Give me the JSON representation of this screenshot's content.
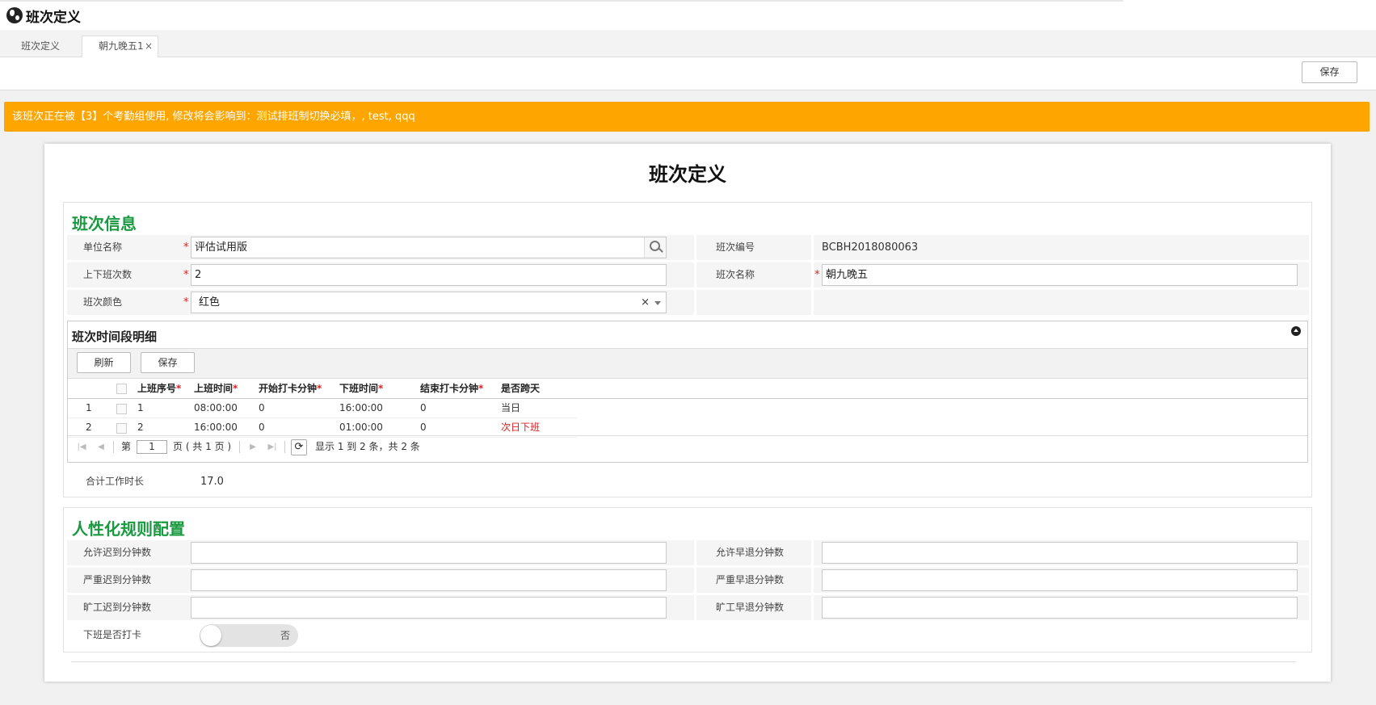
{
  "app": {
    "title": "班次定义"
  },
  "tabs": [
    {
      "label": "班次定义"
    },
    {
      "label": "朝九晚五1",
      "close": "×"
    }
  ],
  "toolbar": {
    "save_label": "保存"
  },
  "warning": {
    "text": "该班次正在被【3】个考勤组使用, 修改将会影响到：测试排班制切换必填，, test, qqq"
  },
  "form": {
    "title": "班次定义",
    "info_section": {
      "title": "班次信息",
      "unit_name_label": "单位名称",
      "unit_name_value": "评估试用版",
      "shift_code_label": "班次编号",
      "shift_code_value": "BCBH2018080063",
      "count_label": "上下班次数",
      "count_value": "2",
      "shift_name_label": "班次名称",
      "shift_name_value": "朝九晚五",
      "color_label": "班次颜色",
      "color_value": "红色",
      "clear": "×",
      "required_mark": "*"
    },
    "detail": {
      "title": "班次时间段明细",
      "refresh_label": "刷新",
      "save_label": "保存",
      "columns": [
        "上班序号",
        "上班时间",
        "开始打卡分钟",
        "下班时间",
        "结束打卡分钟",
        "是否跨天"
      ],
      "rows": [
        {
          "idx": "1",
          "seq": "1",
          "on_time": "08:00:00",
          "start_min": "0",
          "off_time": "16:00:00",
          "end_min": "0",
          "cross_day": "当日"
        },
        {
          "idx": "2",
          "seq": "2",
          "on_time": "16:00:00",
          "start_min": "0",
          "off_time": "01:00:00",
          "end_min": "0",
          "cross_day": "次日下班"
        }
      ],
      "pager": {
        "page_prefix": "第",
        "page_value": "1",
        "page_suffix": "页 ( 共 1 页 )",
        "summary": "显示 1 到 2 条，共 2 条"
      }
    },
    "total_label": "合计工作时长",
    "total_value": "17.0",
    "rules_section": {
      "title": "人性化规则配置",
      "late_allow_label": "允许迟到分钟数",
      "early_allow_label": "允许早退分钟数",
      "late_serious_label": "严重迟到分钟数",
      "early_serious_label": "严重早退分钟数",
      "late_absent_label": "旷工迟到分钟数",
      "early_absent_label": "旷工早退分钟数",
      "clock_out_label": "下班是否打卡",
      "clock_out_value": "否"
    }
  }
}
